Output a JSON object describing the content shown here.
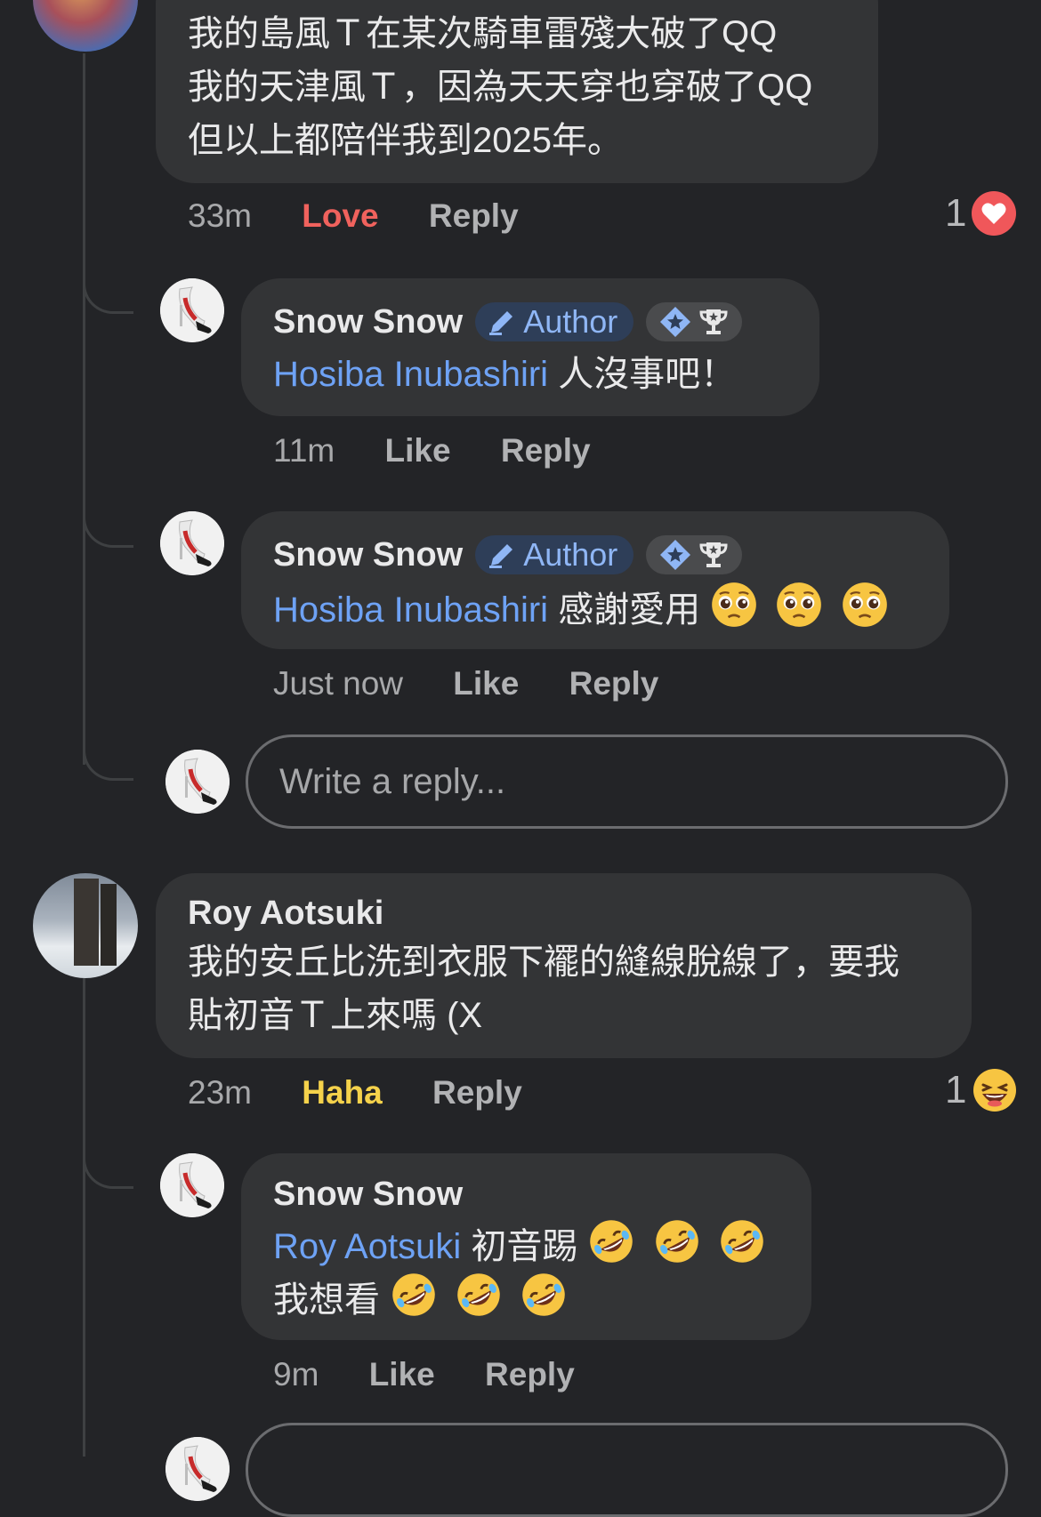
{
  "comments": [
    {
      "text_lines": [
        "我的島風Ｔ在某次騎車雷殘大破了QQ",
        "我的天津風Ｔ，因為天天穿也穿破了QQ",
        "但以上都陪伴我到2025年。"
      ],
      "time": "33m",
      "reaction_label": "Love",
      "reply_label": "Reply",
      "reaction_count": "1",
      "reaction_icon": "heart-icon",
      "replies": [
        {
          "name": "Snow Snow",
          "badge": "Author",
          "mention": "Hosiba Inubashiri",
          "text": "人沒事吧！",
          "time": "11m",
          "like_label": "Like",
          "reply_label": "Reply"
        },
        {
          "name": "Snow Snow",
          "badge": "Author",
          "mention": "Hosiba Inubashiri",
          "text": "感謝愛用",
          "emoji": "pleading-face-icon",
          "time": "Just now",
          "like_label": "Like",
          "reply_label": "Reply"
        }
      ],
      "reply_placeholder": "Write a reply..."
    },
    {
      "name": "Roy Aotsuki",
      "text_lines": [
        "我的安丘比洗到衣服下襬的縫線脫線了，要我",
        "貼初音Ｔ上來嗎 (X"
      ],
      "time": "23m",
      "reaction_label": "Haha",
      "reply_label": "Reply",
      "reaction_count": "1",
      "reaction_icon": "laughing-face-icon",
      "replies": [
        {
          "name": "Snow Snow",
          "mention": "Roy Aotsuki",
          "text": "初音踢",
          "text_line2": "我想看",
          "emoji": "rolling-laughing-face-icon",
          "time": "9m",
          "like_label": "Like",
          "reply_label": "Reply"
        }
      ]
    }
  ],
  "colors": {
    "background": "#232427",
    "bubble": "#333436",
    "mention": "#6ea2f5",
    "love": "#f0625d",
    "haha": "#f5d24b"
  }
}
